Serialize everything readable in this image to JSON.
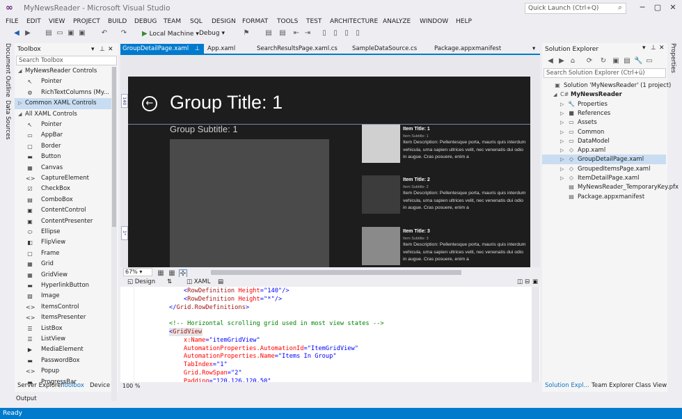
{
  "window": {
    "title": "MyNewsReader - Microsoft Visual Studio",
    "quick_launch_placeholder": "Quick Launch (Ctrl+Q)"
  },
  "menu": [
    "FILE",
    "EDIT",
    "VIEW",
    "PROJECT",
    "BUILD",
    "DEBUG",
    "TEAM",
    "SQL",
    "DESIGN",
    "FORMAT",
    "TOOLS",
    "TEST",
    "ARCHITECTURE",
    "ANALYZE",
    "WINDOW",
    "HELP"
  ],
  "toolbar": {
    "run_label": "Local Machine",
    "config_label": "Debug"
  },
  "left_vertical_tabs": [
    "Document Outline",
    "Data Sources"
  ],
  "toolbox": {
    "title": "Toolbox",
    "search_placeholder": "Search Toolbox",
    "rows": [
      {
        "type": "cat",
        "label": "MyNewsReader Controls",
        "exp": "◢"
      },
      {
        "type": "item",
        "label": "Pointer",
        "icon": "pointer-icon",
        "glyph": "↖"
      },
      {
        "type": "item",
        "label": "RichTextColumns (My...",
        "icon": "control-icon",
        "glyph": "⚙"
      },
      {
        "type": "cat",
        "label": "Common XAML Controls",
        "exp": "▷",
        "sel": true
      },
      {
        "type": "cat",
        "label": "All XAML Controls",
        "exp": "◢"
      },
      {
        "type": "item",
        "label": "Pointer",
        "icon": "pointer-icon",
        "glyph": "↖"
      },
      {
        "type": "item",
        "label": "AppBar",
        "icon": "appbar-icon",
        "glyph": "▭"
      },
      {
        "type": "item",
        "label": "Border",
        "icon": "border-icon",
        "glyph": "▢"
      },
      {
        "type": "item",
        "label": "Button",
        "icon": "button-icon",
        "glyph": "▬"
      },
      {
        "type": "item",
        "label": "Canvas",
        "icon": "canvas-icon",
        "glyph": "▦"
      },
      {
        "type": "item",
        "label": "CaptureElement",
        "icon": "capture-icon",
        "glyph": "<>"
      },
      {
        "type": "item",
        "label": "CheckBox",
        "icon": "checkbox-icon",
        "glyph": "☑"
      },
      {
        "type": "item",
        "label": "ComboBox",
        "icon": "combobox-icon",
        "glyph": "▤"
      },
      {
        "type": "item",
        "label": "ContentControl",
        "icon": "contentcontrol-icon",
        "glyph": "▣"
      },
      {
        "type": "item",
        "label": "ContentPresenter",
        "icon": "contentpresenter-icon",
        "glyph": "▣"
      },
      {
        "type": "item",
        "label": "Ellipse",
        "icon": "ellipse-icon",
        "glyph": "⬭"
      },
      {
        "type": "item",
        "label": "FlipView",
        "icon": "flipview-icon",
        "glyph": "◧"
      },
      {
        "type": "item",
        "label": "Frame",
        "icon": "frame-icon",
        "glyph": "▢"
      },
      {
        "type": "item",
        "label": "Grid",
        "icon": "grid-icon",
        "glyph": "▦"
      },
      {
        "type": "item",
        "label": "GridView",
        "icon": "gridview-icon",
        "glyph": "▦"
      },
      {
        "type": "item",
        "label": "HyperlinkButton",
        "icon": "hyperlink-icon",
        "glyph": "▬"
      },
      {
        "type": "item",
        "label": "Image",
        "icon": "image-icon",
        "glyph": "▨"
      },
      {
        "type": "item",
        "label": "ItemsControl",
        "icon": "itemscontrol-icon",
        "glyph": "<>"
      },
      {
        "type": "item",
        "label": "ItemsPresenter",
        "icon": "itemspresenter-icon",
        "glyph": "<>"
      },
      {
        "type": "item",
        "label": "ListBox",
        "icon": "listbox-icon",
        "glyph": "☰"
      },
      {
        "type": "item",
        "label": "ListView",
        "icon": "listview-icon",
        "glyph": "☰"
      },
      {
        "type": "item",
        "label": "MediaElement",
        "icon": "media-icon",
        "glyph": "▶"
      },
      {
        "type": "item",
        "label": "PasswordBox",
        "icon": "passwordbox-icon",
        "glyph": "▬"
      },
      {
        "type": "item",
        "label": "Popup",
        "icon": "popup-icon",
        "glyph": "<>"
      },
      {
        "type": "item",
        "label": "ProgressBar",
        "icon": "progressbar-icon",
        "glyph": "▬"
      }
    ],
    "bottom_tabs": [
      "Server Explorer",
      "Toolbox",
      "Device"
    ]
  },
  "doc_tabs": [
    "GroupDetailPage.xaml",
    "App.xaml",
    "SearchResultsPage.xaml.cs",
    "SampleDataSource.cs",
    "Package.appxmanifest"
  ],
  "designer": {
    "group_title": "Group Title: 1",
    "group_subtitle": "Group Subtitle: 1",
    "ruler_marks": [
      "140",
      "1*"
    ],
    "items": [
      {
        "title": "Item Title: 1",
        "subtitle": "Item Subtitle: 1",
        "desc": "Item Description: Pellentesque porta, mauris quis interdum vehicula, urna sapien ultrices velit, nec venenatis dui odio in augue. Cras posuere, enim a",
        "img": "#d0d0d0"
      },
      {
        "title": "Item Title: 2",
        "subtitle": "Item Subtitle: 2",
        "desc": "Item Description: Pellentesque porta, mauris quis interdum vehicula, urna sapien ultrices velit, nec venenatis dui odio in augue. Cras posuere, enim a",
        "img": "#3c3c3c"
      },
      {
        "title": "Item Title: 3",
        "subtitle": "Item Subtitle: 3",
        "desc": "Item Description: Pellentesque porta, mauris quis interdum vehicula, urna sapien ultrices velit, nec venenatis dui odio in augue. Cras posuere, enim a",
        "img": "#8a8a8a"
      }
    ],
    "zoom": "67%"
  },
  "split": {
    "design_label": "Design",
    "xaml_label": "XAML"
  },
  "code_lines": [
    [
      [
        "    ",
        "pun"
      ],
      [
        "<",
        "pun"
      ],
      [
        "RowDefinition",
        "tag"
      ],
      [
        " Height",
        "attr"
      ],
      [
        "=",
        "pun"
      ],
      [
        "\"140\"",
        "val"
      ],
      [
        "/>",
        "pun"
      ]
    ],
    [
      [
        "    ",
        "pun"
      ],
      [
        "<",
        "pun"
      ],
      [
        "RowDefinition",
        "tag"
      ],
      [
        " Height",
        "attr"
      ],
      [
        "=",
        "pun"
      ],
      [
        "\"*\"",
        "val"
      ],
      [
        "/>",
        "pun"
      ]
    ],
    [
      [
        "</",
        "pun"
      ],
      [
        "Grid.RowDefinitions",
        "tag"
      ],
      [
        ">",
        "pun"
      ]
    ],
    [
      [
        "",
        "pun"
      ]
    ],
    [
      [
        "<!-- Horizontal scrolling grid used in most view states -->",
        "cmt"
      ]
    ],
    [
      [
        "<",
        "pun"
      ],
      [
        "GridView",
        "tag"
      ]
    ],
    [
      [
        "    x:Name",
        "attr"
      ],
      [
        "=",
        "pun"
      ],
      [
        "\"itemGridView\"",
        "val"
      ]
    ],
    [
      [
        "    AutomationProperties.AutomationId",
        "attr"
      ],
      [
        "=",
        "pun"
      ],
      [
        "\"ItemGridView\"",
        "val"
      ]
    ],
    [
      [
        "    AutomationProperties.Name",
        "attr"
      ],
      [
        "=",
        "pun"
      ],
      [
        "\"Items In Group\"",
        "val"
      ]
    ],
    [
      [
        "    TabIndex",
        "attr"
      ],
      [
        "=",
        "pun"
      ],
      [
        "\"1\"",
        "val"
      ]
    ],
    [
      [
        "    Grid.RowSpan",
        "attr"
      ],
      [
        "=",
        "pun"
      ],
      [
        "\"2\"",
        "val"
      ]
    ],
    [
      [
        "    Padding",
        "attr"
      ],
      [
        "=",
        "pun"
      ],
      [
        "\"120,126,120,50\"",
        "val"
      ]
    ]
  ],
  "editor_zoom": "100 %",
  "solution_explorer": {
    "title": "Solution Explorer",
    "search_placeholder": "Search Solution Explorer (Ctrl+ü)",
    "rows": [
      {
        "label": "Solution 'MyNewsReader' (1 project)",
        "indent": 0,
        "exp": "",
        "icon": "solution-icon",
        "glyph": "▣"
      },
      {
        "label": "MyNewsReader",
        "indent": 1,
        "exp": "◢",
        "icon": "csharp-project-icon",
        "glyph": "C#",
        "bold": true
      },
      {
        "label": "Properties",
        "indent": 2,
        "exp": "▷",
        "icon": "wrench-icon",
        "glyph": "🔧"
      },
      {
        "label": "References",
        "indent": 2,
        "exp": "▷",
        "icon": "references-icon",
        "glyph": "■"
      },
      {
        "label": "Assets",
        "indent": 2,
        "exp": "▷",
        "icon": "folder-icon",
        "glyph": "▭"
      },
      {
        "label": "Common",
        "indent": 2,
        "exp": "▷",
        "icon": "folder-icon",
        "glyph": "▭"
      },
      {
        "label": "DataModel",
        "indent": 2,
        "exp": "▷",
        "icon": "folder-icon",
        "glyph": "▭"
      },
      {
        "label": "App.xaml",
        "indent": 2,
        "exp": "▷",
        "icon": "xaml-file-icon",
        "glyph": "◇"
      },
      {
        "label": "GroupDetailPage.xaml",
        "indent": 2,
        "exp": "▷",
        "icon": "xaml-file-icon",
        "glyph": "◇",
        "sel": true
      },
      {
        "label": "GroupedItemsPage.xaml",
        "indent": 2,
        "exp": "▷",
        "icon": "xaml-file-icon",
        "glyph": "◇"
      },
      {
        "label": "ItemDetailPage.xaml",
        "indent": 2,
        "exp": "▷",
        "icon": "xaml-file-icon",
        "glyph": "◇"
      },
      {
        "label": "MyNewsReader_TemporaryKey.pfx",
        "indent": 2,
        "exp": "",
        "icon": "key-file-icon",
        "glyph": "▤"
      },
      {
        "label": "Package.appxmanifest",
        "indent": 2,
        "exp": "",
        "icon": "manifest-icon",
        "glyph": "▤"
      }
    ],
    "bottom_tabs": [
      "Solution Expl...",
      "Team Explorer",
      "Class View"
    ]
  },
  "right_vertical_tab": "Properties",
  "output_tab": "Output",
  "status": "Ready",
  "colors": {
    "accent": "#007acc",
    "artboard": "#1d1d1d",
    "selection": "#c9ddf2"
  }
}
